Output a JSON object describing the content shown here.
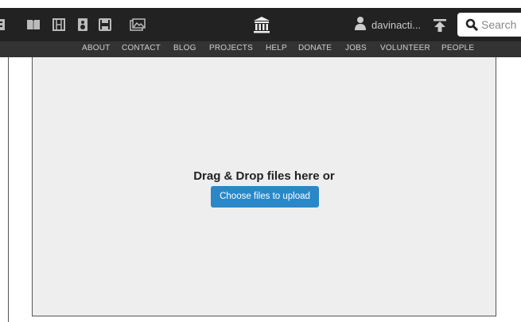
{
  "topbar": {
    "media_icons": [
      "texts-icon",
      "video-icon",
      "audio-icon",
      "software-icon",
      "images-icon"
    ],
    "logo_icon": "archive-building-icon",
    "user": {
      "icon": "user-icon",
      "label": "davinacti..."
    },
    "upload_icon": "upload-icon",
    "search": {
      "icon": "search-icon",
      "placeholder": "Search"
    }
  },
  "nav": {
    "items": [
      "ABOUT",
      "CONTACT",
      "BLOG",
      "PROJECTS",
      "HELP",
      "DONATE",
      "JOBS",
      "VOLUNTEER",
      "PEOPLE"
    ]
  },
  "dropzone": {
    "text": "Drag & Drop files here or",
    "button_label": "Choose files to upload"
  },
  "colors": {
    "topbar_bg": "#222222",
    "navbar_bg": "#333333",
    "dropzone_bg": "#eeeeee",
    "button_bg": "#2a88c9"
  }
}
